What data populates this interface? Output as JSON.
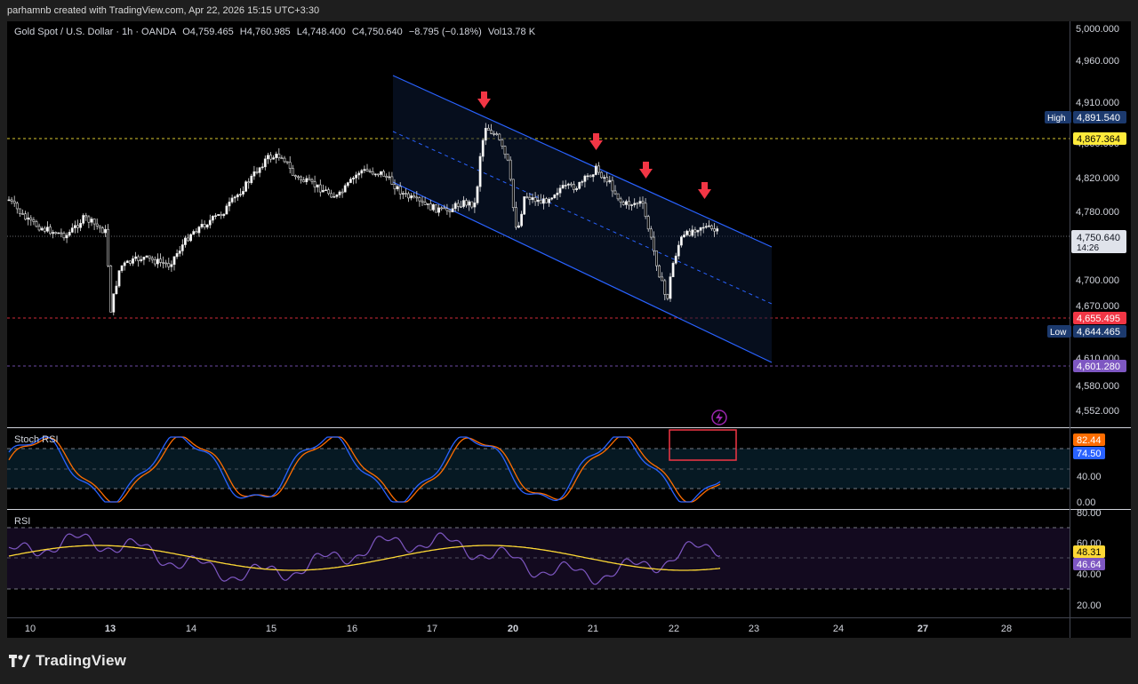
{
  "header": {
    "caption": "parhamnb created with TradingView.com, Apr 22, 2026 15:15 UTC+3:30"
  },
  "legend": {
    "symbol": "Gold Spot / U.S. Dollar · 1h · OANDA",
    "open": "O4,759.465",
    "high": "H4,760.985",
    "low": "L4,748.400",
    "close": "C4,750.640",
    "change": "−8.795 (−0.18%)",
    "volume": "Vol13.78 K"
  },
  "price_axis": {
    "ticks": [
      "5,000.000",
      "4,960.000",
      "4,910.000",
      "4,820.000",
      "4,780.000",
      "4,700.000",
      "4,670.000",
      "4,610.000",
      "4,580.000",
      "4,552.000"
    ],
    "hidden_tick": "4,860.000",
    "last_price": "4,750.640",
    "countdown": "14:26",
    "high_label": "High",
    "high_value": "4,891.540",
    "low_label": "Low",
    "low_value": "4,644.465",
    "level_yellow": "4,867.364",
    "level_red": "4,655.495",
    "level_purple": "4,601.280"
  },
  "stoch": {
    "title": "Stoch RSI",
    "k_value": "82.44",
    "d_value": "74.50",
    "ticks": [
      "40.00",
      "0.00"
    ]
  },
  "rsi": {
    "title": "RSI",
    "rsi_value": "46.64",
    "ma_value": "48.31",
    "ticks": [
      "80.00",
      "60.00",
      "40.00",
      "20.00"
    ]
  },
  "time_axis": {
    "labels": [
      "10",
      "13",
      "14",
      "15",
      "16",
      "17",
      "20",
      "21",
      "22",
      "23",
      "24",
      "27",
      "28"
    ]
  },
  "footer": {
    "brand": "TradingView"
  },
  "colors": {
    "channel": "#2962ff",
    "arrow": "#f23645",
    "yellow_level": "#ffeb3b",
    "red_level": "#f23645",
    "purple_level": "#7e57c2",
    "stoch_k": "#2962ff",
    "stoch_d": "#ff6d00",
    "rsi": "#7e57c2",
    "rsi_ma": "#fdd835"
  },
  "icons": {
    "alert": "lightning-icon",
    "markers": "arrow-down-icon"
  }
}
